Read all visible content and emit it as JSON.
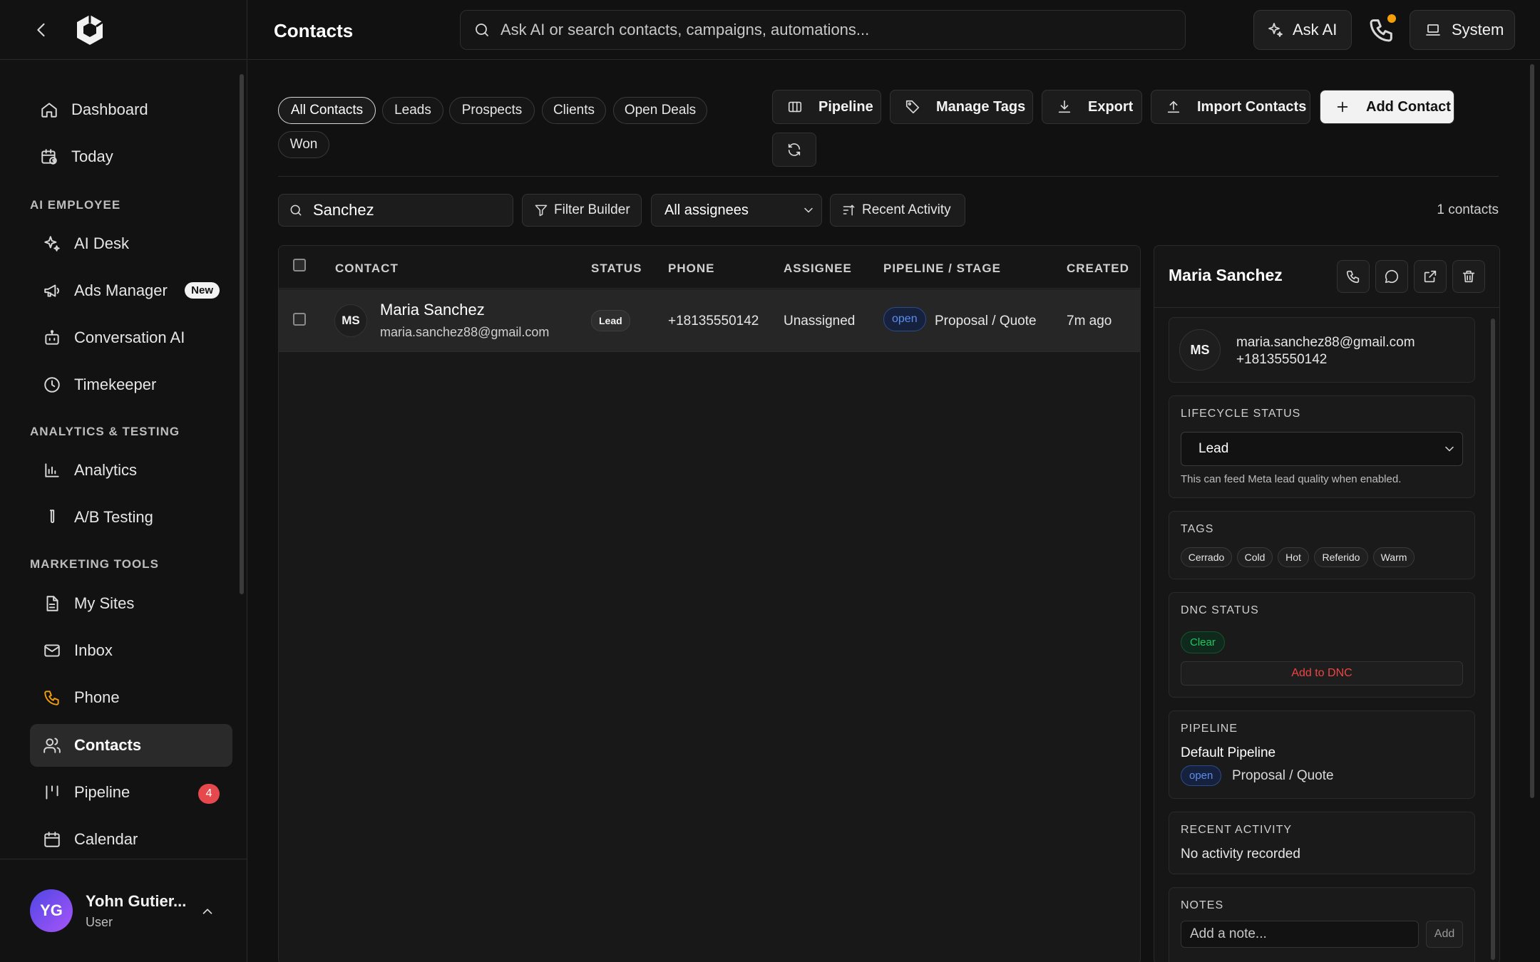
{
  "sidebar": {
    "items": [
      {
        "label": "Dashboard",
        "icon": "home-icon"
      },
      {
        "label": "Today",
        "icon": "calendar-clock-icon"
      },
      {
        "label": "AI Desk",
        "icon": "sparkles-icon"
      },
      {
        "label": "Ads Manager",
        "icon": "megaphone-icon",
        "badge": "New"
      },
      {
        "label": "Conversation AI",
        "icon": "bot-icon"
      },
      {
        "label": "Timekeeper",
        "icon": "clock-icon"
      },
      {
        "label": "Analytics",
        "icon": "bar-chart-icon"
      },
      {
        "label": "A/B Testing",
        "icon": "test-tube-icon"
      },
      {
        "label": "My Sites",
        "icon": "file-icon"
      },
      {
        "label": "Inbox",
        "icon": "mail-icon"
      },
      {
        "label": "Phone",
        "icon": "phone-icon"
      },
      {
        "label": "Contacts",
        "icon": "users-icon"
      },
      {
        "label": "Pipeline",
        "icon": "pipeline-icon",
        "badge": "4"
      },
      {
        "label": "Calendar",
        "icon": "calendar-icon"
      }
    ],
    "sections": {
      "ai_employee": "AI EMPLOYEE",
      "analytics_testing": "ANALYTICS & TESTING",
      "marketing_tools": "MARKETING TOOLS"
    },
    "user": {
      "initials": "YG",
      "name": "Yohn Gutier...",
      "role": "User"
    }
  },
  "header": {
    "title": "Contacts",
    "search_placeholder": "Ask AI or search contacts, campaigns, automations...",
    "ask_ai": "Ask AI",
    "system": "System"
  },
  "filters": [
    "All Contacts",
    "Leads",
    "Prospects",
    "Clients",
    "Open Deals",
    "Won"
  ],
  "actions": {
    "pipeline": "Pipeline",
    "manage_tags": "Manage Tags",
    "export": "Export",
    "import": "Import Contacts",
    "add": "Add Contact"
  },
  "toolbar": {
    "search_value": "Sanchez",
    "filter_builder": "Filter Builder",
    "assignee": "All assignees",
    "recent_activity": "Recent Activity",
    "count": "1 contacts"
  },
  "table": {
    "headers": {
      "contact": "CONTACT",
      "status": "STATUS",
      "phone": "PHONE",
      "assignee": "ASSIGNEE",
      "pipeline": "PIPELINE / STAGE",
      "created": "CREATED"
    },
    "rows": [
      {
        "initials": "MS",
        "name": "Maria Sanchez",
        "email": "maria.sanchez88@gmail.com",
        "status": "Lead",
        "phone": "+18135550142",
        "assignee": "Unassigned",
        "deal_state": "open",
        "stage": "Proposal / Quote",
        "created": "7m ago"
      }
    ]
  },
  "details": {
    "name": "Maria Sanchez",
    "initials": "MS",
    "email": "maria.sanchez88@gmail.com",
    "phone": "+18135550142",
    "lifecycle": {
      "title": "LIFECYCLE STATUS",
      "value": "Lead",
      "hint": "This can feed Meta lead quality when enabled."
    },
    "tags": {
      "title": "TAGS",
      "items": [
        "Cerrado",
        "Cold",
        "Hot",
        "Referido",
        "Warm"
      ]
    },
    "dnc": {
      "title": "DNC STATUS",
      "status": "Clear",
      "action": "Add to DNC"
    },
    "pipeline": {
      "title": "PIPELINE",
      "name": "Default Pipeline",
      "state": "open",
      "stage": "Proposal / Quote"
    },
    "activity": {
      "title": "RECENT ACTIVITY",
      "text": "No activity recorded"
    },
    "notes": {
      "title": "NOTES",
      "placeholder": "Add a note...",
      "add": "Add"
    }
  },
  "colors": {
    "accent_badge": "#e5484d",
    "open_badge": "#5b8def",
    "clear_badge": "#22c55e",
    "dnc": "#ef4444",
    "phone_icon": "#f59e0b"
  }
}
